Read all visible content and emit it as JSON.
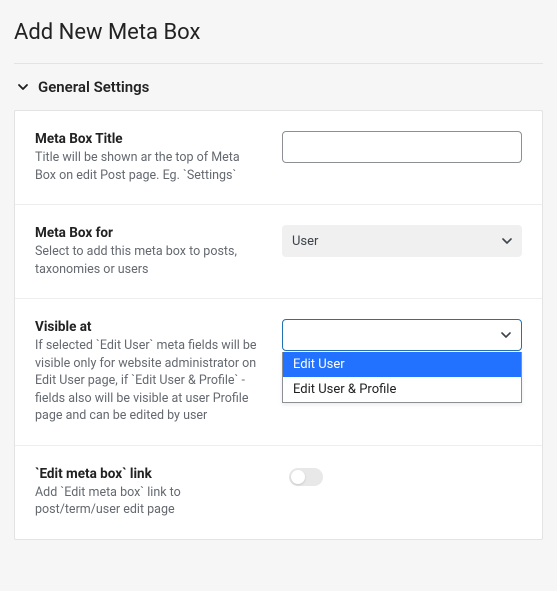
{
  "page": {
    "heading": "Add New Meta Box",
    "section_label": "General Settings"
  },
  "fields": {
    "title": {
      "label": "Meta Box Title",
      "desc": "Title will be shown ar the top of Meta Box on edit Post page. Eg. `Settings`",
      "value": ""
    },
    "for": {
      "label": "Meta Box for",
      "desc": "Select to add this meta box to posts, taxonomies or users",
      "selected": "User"
    },
    "visible": {
      "label": "Visible at",
      "desc": "If selected `Edit User` meta fields will be visible only for website administrator on Edit User page, if `Edit User & Profile` - fields also will be visible at user Profile page and can be edited by user",
      "selected": "",
      "options": [
        "Edit User",
        "Edit User & Profile"
      ],
      "highlighted": "Edit User"
    },
    "editlink": {
      "label": "`Edit meta box` link",
      "desc": "Add `Edit meta box` link to post/term/user edit page",
      "value": false
    }
  }
}
